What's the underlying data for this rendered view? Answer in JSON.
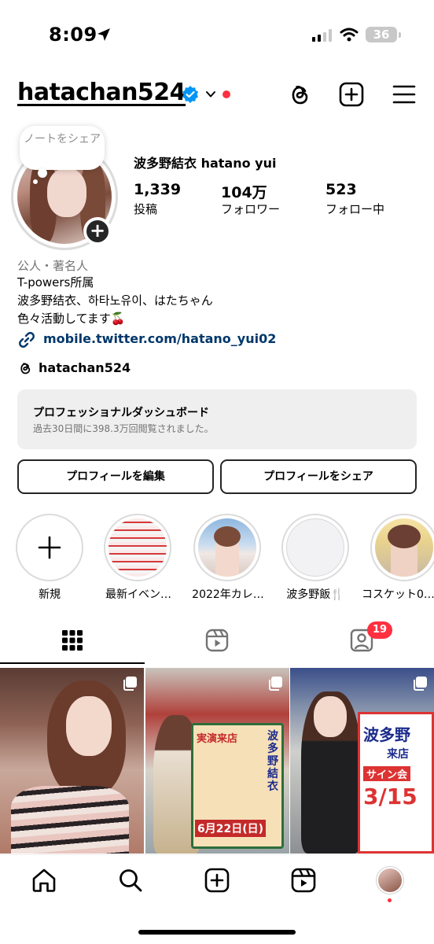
{
  "status_bar": {
    "time": "8:09",
    "battery": "36"
  },
  "header": {
    "username": "hatachan524"
  },
  "profile": {
    "note_placeholder": "ノートをシェア",
    "display_name": "波多野結衣 hatano yui",
    "stats": [
      {
        "value": "1,339",
        "label": "投稿"
      },
      {
        "value": "104万",
        "label": "フォロワー"
      },
      {
        "value": "523",
        "label": "フォロー中"
      }
    ],
    "category": "公人・著名人",
    "bio": [
      "T-powers所属",
      "波多野结衣、하타노유이、はたちゃん",
      "色々活動してます🍒"
    ],
    "link": "mobile.twitter.com/hatano_yui02",
    "threads_name": "hatachan524"
  },
  "dashboard": {
    "title": "プロフェッショナルダッシュボード",
    "subtitle": "過去30日間に398.3万回閲覧されました。"
  },
  "buttons": {
    "edit": "プロフィールを編集",
    "share": "プロフィールをシェア"
  },
  "highlights": [
    {
      "label": "新規"
    },
    {
      "label": "最新イベン…"
    },
    {
      "label": "2022年カレ…"
    },
    {
      "label": "波多野飯🍴"
    },
    {
      "label": "コスケット0…"
    }
  ],
  "tabs": {
    "tagged_count": "19"
  },
  "grid": [
    {
      "type": "carousel"
    },
    {
      "type": "carousel",
      "sign_text": [
        "実演来店",
        "6月22日(日)",
        "波多野結衣"
      ]
    },
    {
      "type": "carousel",
      "sign_text": [
        "波多野",
        "来店",
        "サイン会",
        "3/15"
      ]
    }
  ],
  "colors": {
    "accent_red": "#ff3040",
    "verified_blue": "#0095f6",
    "link": "#00376b"
  }
}
